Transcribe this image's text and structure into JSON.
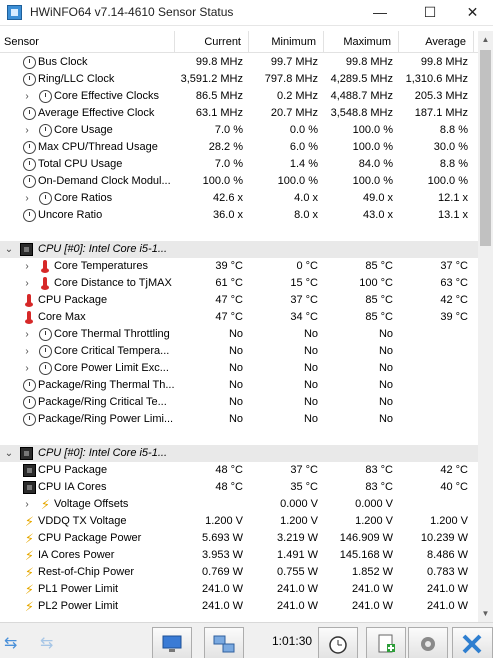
{
  "window": {
    "title": "HWiNFO64 v7.14-4610 Sensor Status",
    "minimize_glyph": "—",
    "maximize_glyph": "☐",
    "close_glyph": "✕"
  },
  "columns": [
    "Sensor",
    "Current",
    "Minimum",
    "Maximum",
    "Average"
  ],
  "rows": [
    {
      "name": "Bus Clock",
      "icon": "clock-icon",
      "expand": false,
      "cur": "99.8 MHz",
      "min": "99.7 MHz",
      "max": "99.8 MHz",
      "avg": "99.8 MHz"
    },
    {
      "name": "Ring/LLC Clock",
      "icon": "clock-icon",
      "expand": false,
      "cur": "3,591.2 MHz",
      "min": "797.8 MHz",
      "max": "4,289.5 MHz",
      "avg": "1,310.6 MHz"
    },
    {
      "name": "Core Effective Clocks",
      "icon": "clock-icon",
      "expand": true,
      "cur": "86.5 MHz",
      "min": "0.2 MHz",
      "max": "4,488.7 MHz",
      "avg": "205.3 MHz"
    },
    {
      "name": "Average Effective Clock",
      "icon": "clock-icon",
      "expand": false,
      "cur": "63.1 MHz",
      "min": "20.7 MHz",
      "max": "3,548.8 MHz",
      "avg": "187.1 MHz"
    },
    {
      "name": "Core Usage",
      "icon": "clock-icon",
      "expand": true,
      "cur": "7.0 %",
      "min": "0.0 %",
      "max": "100.0 %",
      "avg": "8.8 %"
    },
    {
      "name": "Max CPU/Thread Usage",
      "icon": "clock-icon",
      "expand": false,
      "cur": "28.2 %",
      "min": "6.0 %",
      "max": "100.0 %",
      "avg": "30.0 %"
    },
    {
      "name": "Total CPU Usage",
      "icon": "clock-icon",
      "expand": false,
      "cur": "7.0 %",
      "min": "1.4 %",
      "max": "84.0 %",
      "avg": "8.8 %"
    },
    {
      "name": "On-Demand Clock Modul...",
      "icon": "clock-icon",
      "expand": false,
      "cur": "100.0 %",
      "min": "100.0 %",
      "max": "100.0 %",
      "avg": "100.0 %"
    },
    {
      "name": "Core Ratios",
      "icon": "clock-icon",
      "expand": true,
      "cur": "42.6 x",
      "min": "4.0 x",
      "max": "49.0 x",
      "avg": "12.1 x"
    },
    {
      "name": "Uncore Ratio",
      "icon": "clock-icon",
      "expand": false,
      "cur": "36.0 x",
      "min": "8.0 x",
      "max": "43.0 x",
      "avg": "13.1 x"
    },
    {
      "type": "spacer"
    },
    {
      "type": "group",
      "name": "CPU [#0]: Intel Core i5-1..."
    },
    {
      "name": "Core Temperatures",
      "icon": "thermometer-icon",
      "expand": true,
      "cur": "39 °C",
      "min": "0 °C",
      "max": "85 °C",
      "avg": "37 °C"
    },
    {
      "name": "Core Distance to TjMAX",
      "icon": "thermometer-icon",
      "expand": true,
      "cur": "61 °C",
      "min": "15 °C",
      "max": "100 °C",
      "avg": "63 °C"
    },
    {
      "name": "CPU Package",
      "icon": "thermometer-icon",
      "expand": false,
      "cur": "47 °C",
      "min": "37 °C",
      "max": "85 °C",
      "avg": "42 °C"
    },
    {
      "name": "Core Max",
      "icon": "thermometer-icon",
      "expand": false,
      "cur": "47 °C",
      "min": "34 °C",
      "max": "85 °C",
      "avg": "39 °C"
    },
    {
      "name": "Core Thermal Throttling",
      "icon": "clock-icon",
      "expand": true,
      "cur": "No",
      "min": "No",
      "max": "No",
      "avg": ""
    },
    {
      "name": "Core Critical Tempera...",
      "icon": "clock-icon",
      "expand": true,
      "cur": "No",
      "min": "No",
      "max": "No",
      "avg": ""
    },
    {
      "name": "Core Power Limit Exc...",
      "icon": "clock-icon",
      "expand": true,
      "cur": "No",
      "min": "No",
      "max": "No",
      "avg": ""
    },
    {
      "name": "Package/Ring Thermal Th...",
      "icon": "clock-icon",
      "expand": false,
      "cur": "No",
      "min": "No",
      "max": "No",
      "avg": ""
    },
    {
      "name": "Package/Ring Critical Te...",
      "icon": "clock-icon",
      "expand": false,
      "cur": "No",
      "min": "No",
      "max": "No",
      "avg": ""
    },
    {
      "name": "Package/Ring Power Limi...",
      "icon": "clock-icon",
      "expand": false,
      "cur": "No",
      "min": "No",
      "max": "No",
      "avg": ""
    },
    {
      "type": "spacer"
    },
    {
      "type": "group",
      "name": "CPU [#0]: Intel Core i5-1..."
    },
    {
      "name": "CPU Package",
      "icon": "chip-icon",
      "expand": false,
      "cur": "48 °C",
      "min": "37 °C",
      "max": "83 °C",
      "avg": "42 °C"
    },
    {
      "name": "CPU IA Cores",
      "icon": "chip-icon",
      "expand": false,
      "cur": "48 °C",
      "min": "35 °C",
      "max": "83 °C",
      "avg": "40 °C"
    },
    {
      "name": "Voltage Offsets",
      "icon": "bolt-icon",
      "expand": true,
      "cur": "",
      "min": "0.000 V",
      "max": "0.000 V",
      "avg": ""
    },
    {
      "name": "VDDQ TX Voltage",
      "icon": "bolt-icon",
      "expand": false,
      "cur": "1.200 V",
      "min": "1.200 V",
      "max": "1.200 V",
      "avg": "1.200 V"
    },
    {
      "name": "CPU Package Power",
      "icon": "bolt-icon",
      "expand": false,
      "cur": "5.693 W",
      "min": "3.219 W",
      "max": "146.909 W",
      "avg": "10.239 W"
    },
    {
      "name": "IA Cores Power",
      "icon": "bolt-icon",
      "expand": false,
      "cur": "3.953 W",
      "min": "1.491 W",
      "max": "145.168 W",
      "avg": "8.486 W"
    },
    {
      "name": "Rest-of-Chip Power",
      "icon": "bolt-icon",
      "expand": false,
      "cur": "0.769 W",
      "min": "0.755 W",
      "max": "1.852 W",
      "avg": "0.783 W"
    },
    {
      "name": "PL1 Power Limit",
      "icon": "bolt-icon",
      "expand": false,
      "cur": "241.0 W",
      "min": "241.0 W",
      "max": "241.0 W",
      "avg": "241.0 W"
    },
    {
      "name": "PL2 Power Limit",
      "icon": "bolt-icon",
      "expand": false,
      "cur": "241.0 W",
      "min": "241.0 W",
      "max": "241.0 W",
      "avg": "241.0 W"
    }
  ],
  "toolbar": {
    "elapsed": "1:01:30",
    "nav_arrows": "⇆",
    "nav_arrows_dim": "⇆"
  },
  "colors": {
    "group_bg": "#e9e9e9",
    "accent": "#4a90d9",
    "close_button": "#2f7fd0"
  }
}
